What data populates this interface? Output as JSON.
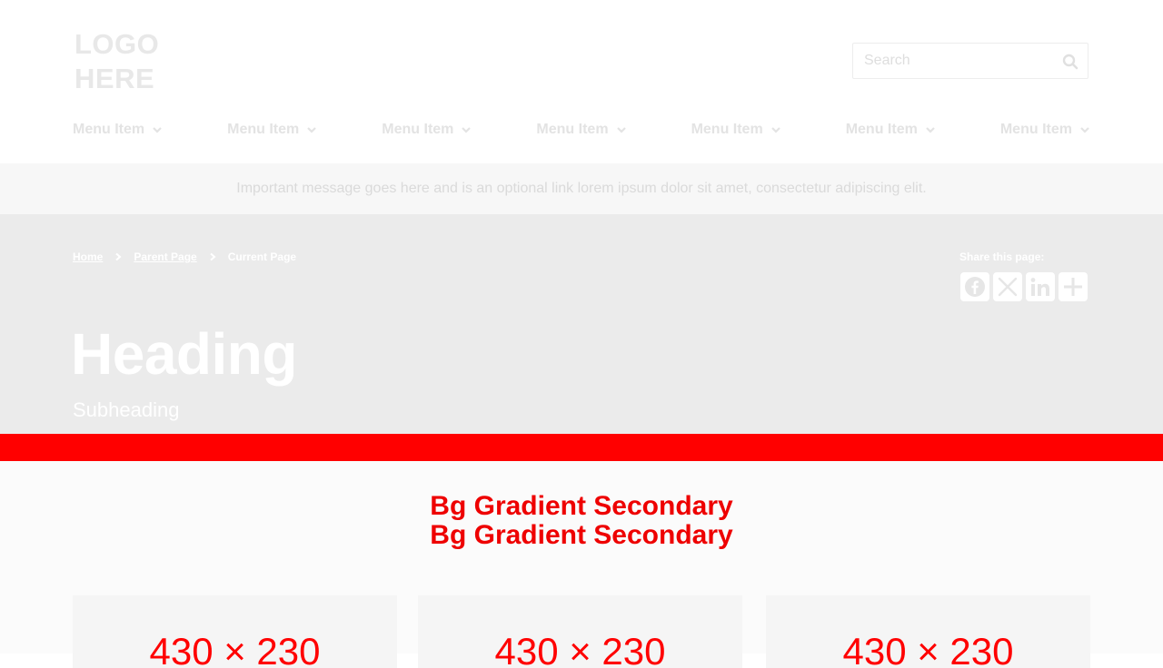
{
  "header": {
    "logo_line1": "LOGO",
    "logo_line2": "HERE",
    "search_placeholder": "Search",
    "search_icon": "search-icon",
    "menu": [
      {
        "label": "Menu Item"
      },
      {
        "label": "Menu Item"
      },
      {
        "label": "Menu Item"
      },
      {
        "label": "Menu Item"
      },
      {
        "label": "Menu Item"
      },
      {
        "label": "Menu Item"
      },
      {
        "label": "Menu Item"
      }
    ]
  },
  "message_bar": {
    "text": "Important message goes here and is an optional link lorem ipsum dolor sit amet, consectetur adipiscing elit."
  },
  "hero": {
    "breadcrumb": {
      "home": "Home",
      "parent": "Parent Page",
      "current": "Current Page"
    },
    "share_label": "Share this page:",
    "share_icons": [
      "facebook-icon",
      "x-icon",
      "linkedin-icon",
      "plus-icon"
    ],
    "heading": "Heading",
    "subheading": "Subheading"
  },
  "section": {
    "title_line1": "Bg Gradient Secondary",
    "title_line2": "Bg Gradient Secondary",
    "cards": [
      {
        "label": "430 × 230"
      },
      {
        "label": "430 × 230"
      },
      {
        "label": "430 × 230"
      }
    ]
  },
  "colors": {
    "accent_red": "#ff0000",
    "hero_bg": "#ebebeb",
    "message_bg": "#f7f7f7"
  }
}
